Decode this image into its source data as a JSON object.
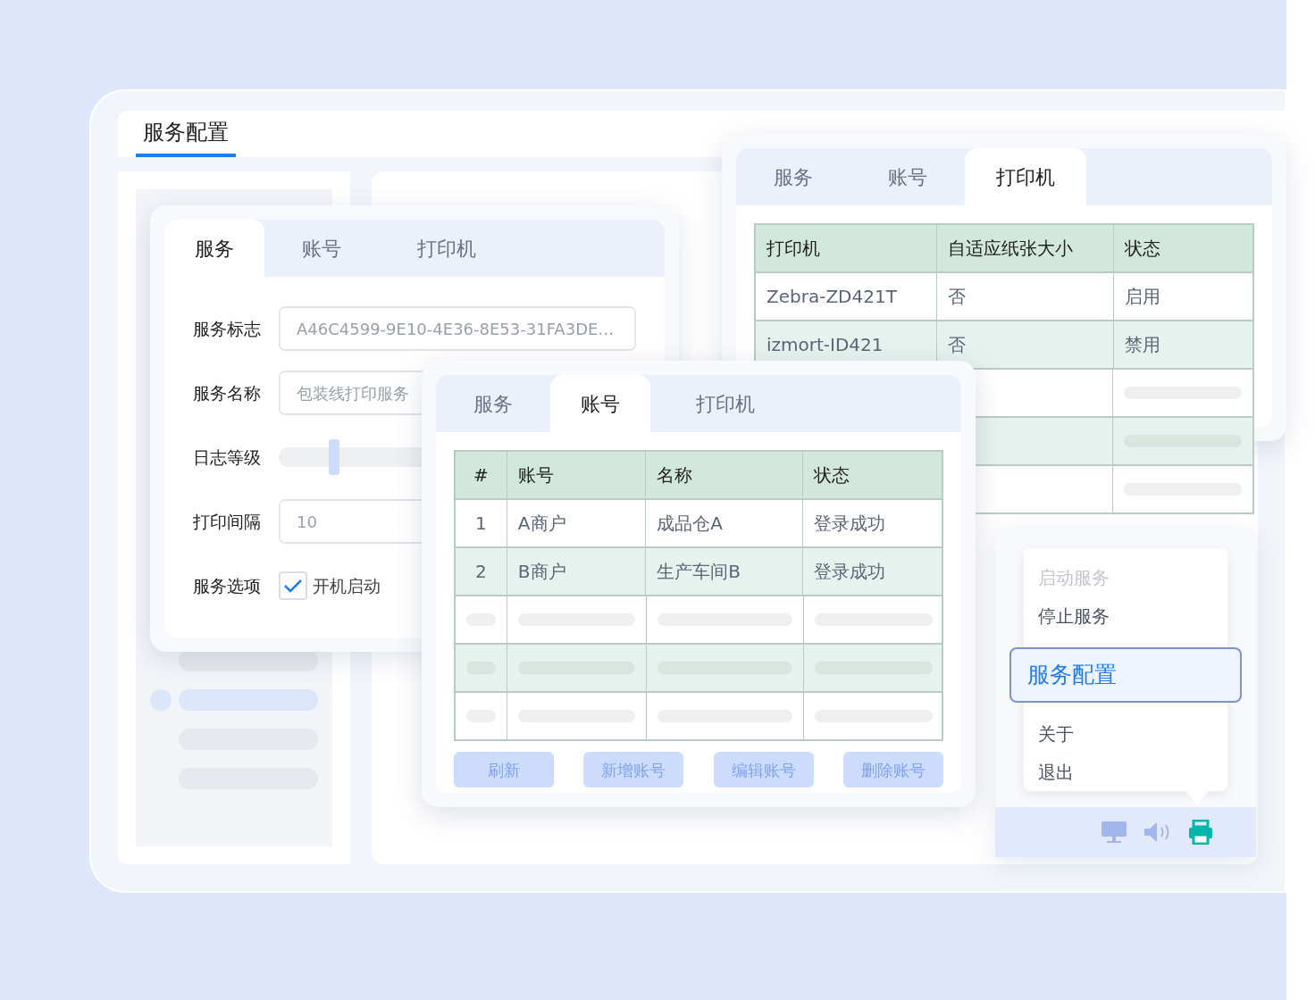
{
  "main_window": {
    "tab": "服务配置"
  },
  "service_card": {
    "tabs": [
      {
        "label": "服务",
        "selected": true
      },
      {
        "label": "账号",
        "selected": false
      },
      {
        "label": "打印机",
        "selected": false
      }
    ],
    "fields": [
      {
        "kind": "text",
        "label": "服务标志",
        "value": "A46C4599-9E10-4E36-8E53-31FA3DE…"
      },
      {
        "kind": "text",
        "label": "服务名称",
        "value": "包装线打印服务"
      },
      {
        "kind": "slider",
        "label": "日志等级",
        "level": 0.14
      },
      {
        "kind": "text",
        "label": "打印间隔",
        "value": "10"
      },
      {
        "kind": "checkbox",
        "label": "服务选项",
        "option": "开机启动",
        "checked": true
      }
    ]
  },
  "printer_card": {
    "tabs": [
      {
        "label": "服务",
        "selected": false
      },
      {
        "label": "账号",
        "selected": false
      },
      {
        "label": "打印机",
        "selected": true
      }
    ],
    "table": {
      "columns": [
        "打印机",
        "自适应纸张大小",
        "状态"
      ],
      "rows": [
        [
          "Zebra-ZD421T",
          "否",
          "启用"
        ],
        [
          "izmort-ID421",
          "否",
          "禁用"
        ]
      ]
    }
  },
  "accounts_card": {
    "tabs": [
      {
        "label": "服务",
        "selected": false
      },
      {
        "label": "账号",
        "selected": true
      },
      {
        "label": "打印机",
        "selected": false
      }
    ],
    "table": {
      "columns": [
        "#",
        "账号",
        "名称",
        "状态"
      ],
      "rows": [
        [
          "1",
          "A商户",
          "成品仓A",
          "登录成功"
        ],
        [
          "2",
          "B商户",
          "生产车间B",
          "登录成功"
        ]
      ]
    },
    "buttons": [
      "刷新",
      "新增账号",
      "编辑账号",
      "删除账号"
    ]
  },
  "tray_menu": {
    "items": [
      {
        "label": "启动服务",
        "disabled": true,
        "selected": false
      },
      {
        "label": "停止服务",
        "disabled": false,
        "selected": false
      },
      {
        "label": "服务配置",
        "disabled": false,
        "selected": true
      },
      {
        "label": "关于",
        "disabled": false,
        "selected": false
      },
      {
        "label": "退出",
        "disabled": false,
        "selected": false
      }
    ]
  }
}
